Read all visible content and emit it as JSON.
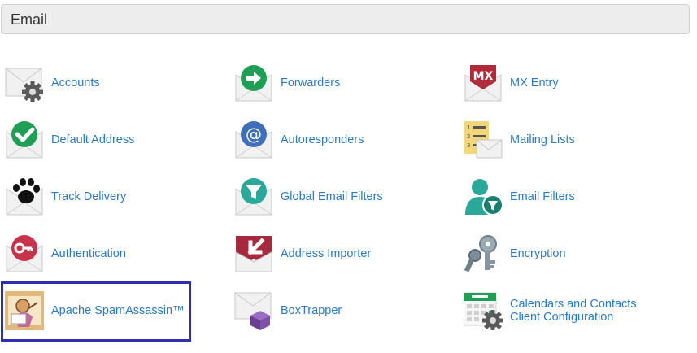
{
  "section": {
    "title": "Email",
    "items": [
      {
        "label": "Accounts",
        "icon": "envelope-gear-icon"
      },
      {
        "label": "Forwarders",
        "icon": "forward-arrow-icon"
      },
      {
        "label": "MX Entry",
        "icon": "mx-entry-icon"
      },
      {
        "label": "Default Address",
        "icon": "check-mark-icon"
      },
      {
        "label": "Autoresponders",
        "icon": "at-sign-icon"
      },
      {
        "label": "Mailing Lists",
        "icon": "mailing-list-icon"
      },
      {
        "label": "Track Delivery",
        "icon": "paw-print-icon"
      },
      {
        "label": "Global Email Filters",
        "icon": "funnel-filter-icon"
      },
      {
        "label": "Email Filters",
        "icon": "user-filter-icon"
      },
      {
        "label": "Authentication",
        "icon": "key-icon"
      },
      {
        "label": "Address Importer",
        "icon": "import-arrow-icon"
      },
      {
        "label": "Encryption",
        "icon": "keys-icon"
      },
      {
        "label": "Apache SpamAssassin™",
        "icon": "spamassassin-icon"
      },
      {
        "label": "BoxTrapper",
        "icon": "box-icon"
      },
      {
        "label_line1": "Calendars and Contacts",
        "label_line2": "Client Configuration",
        "icon": "calendar-gear-icon"
      }
    ]
  },
  "colors": {
    "link": "#2a79c2",
    "header_bg": "#ededed",
    "highlight_border": "#2e2eb0",
    "green": "#1f9e55",
    "teal": "#2aa89a",
    "red": "#c7334a",
    "blue": "#3e6fb8",
    "purple": "#7b4c9f",
    "gear": "#555555"
  }
}
